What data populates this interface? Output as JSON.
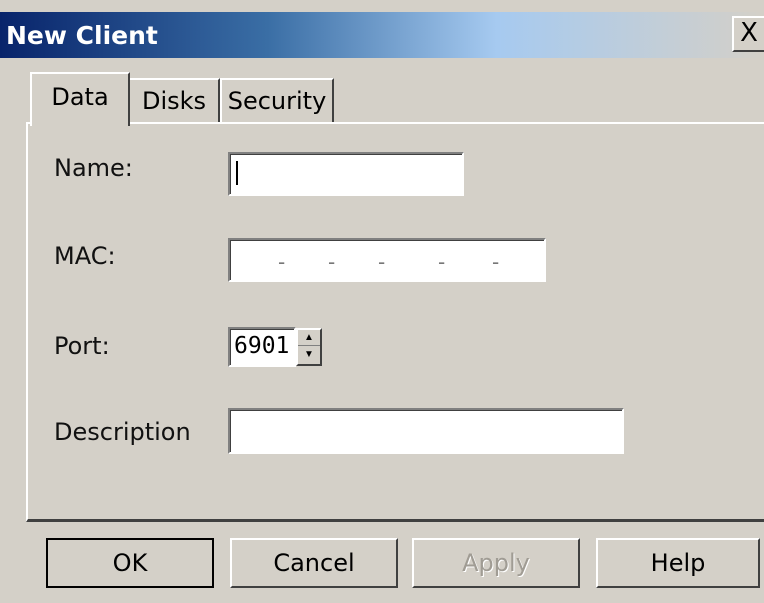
{
  "window": {
    "title": "New Client",
    "close_label": "X"
  },
  "tabs": [
    {
      "label": "Data",
      "active": true
    },
    {
      "label": "Disks",
      "active": false
    },
    {
      "label": "Security",
      "active": false
    }
  ],
  "form": {
    "name": {
      "label": "Name:",
      "value": ""
    },
    "mac": {
      "label": "MAC:",
      "separator": "-",
      "value": ""
    },
    "port": {
      "label": "Port:",
      "value": "6901"
    },
    "description": {
      "label": "Description",
      "value": ""
    }
  },
  "buttons": {
    "ok": "OK",
    "cancel": "Cancel",
    "apply": "Apply",
    "help": "Help"
  },
  "colors": {
    "title_gradient_start": "#08246b",
    "dialog_face": "#d4d0c8",
    "disabled_text": "#a09c94"
  },
  "icons": {
    "close": "close-icon",
    "spin_up": "arrow-up-icon",
    "spin_down": "arrow-down-icon"
  }
}
